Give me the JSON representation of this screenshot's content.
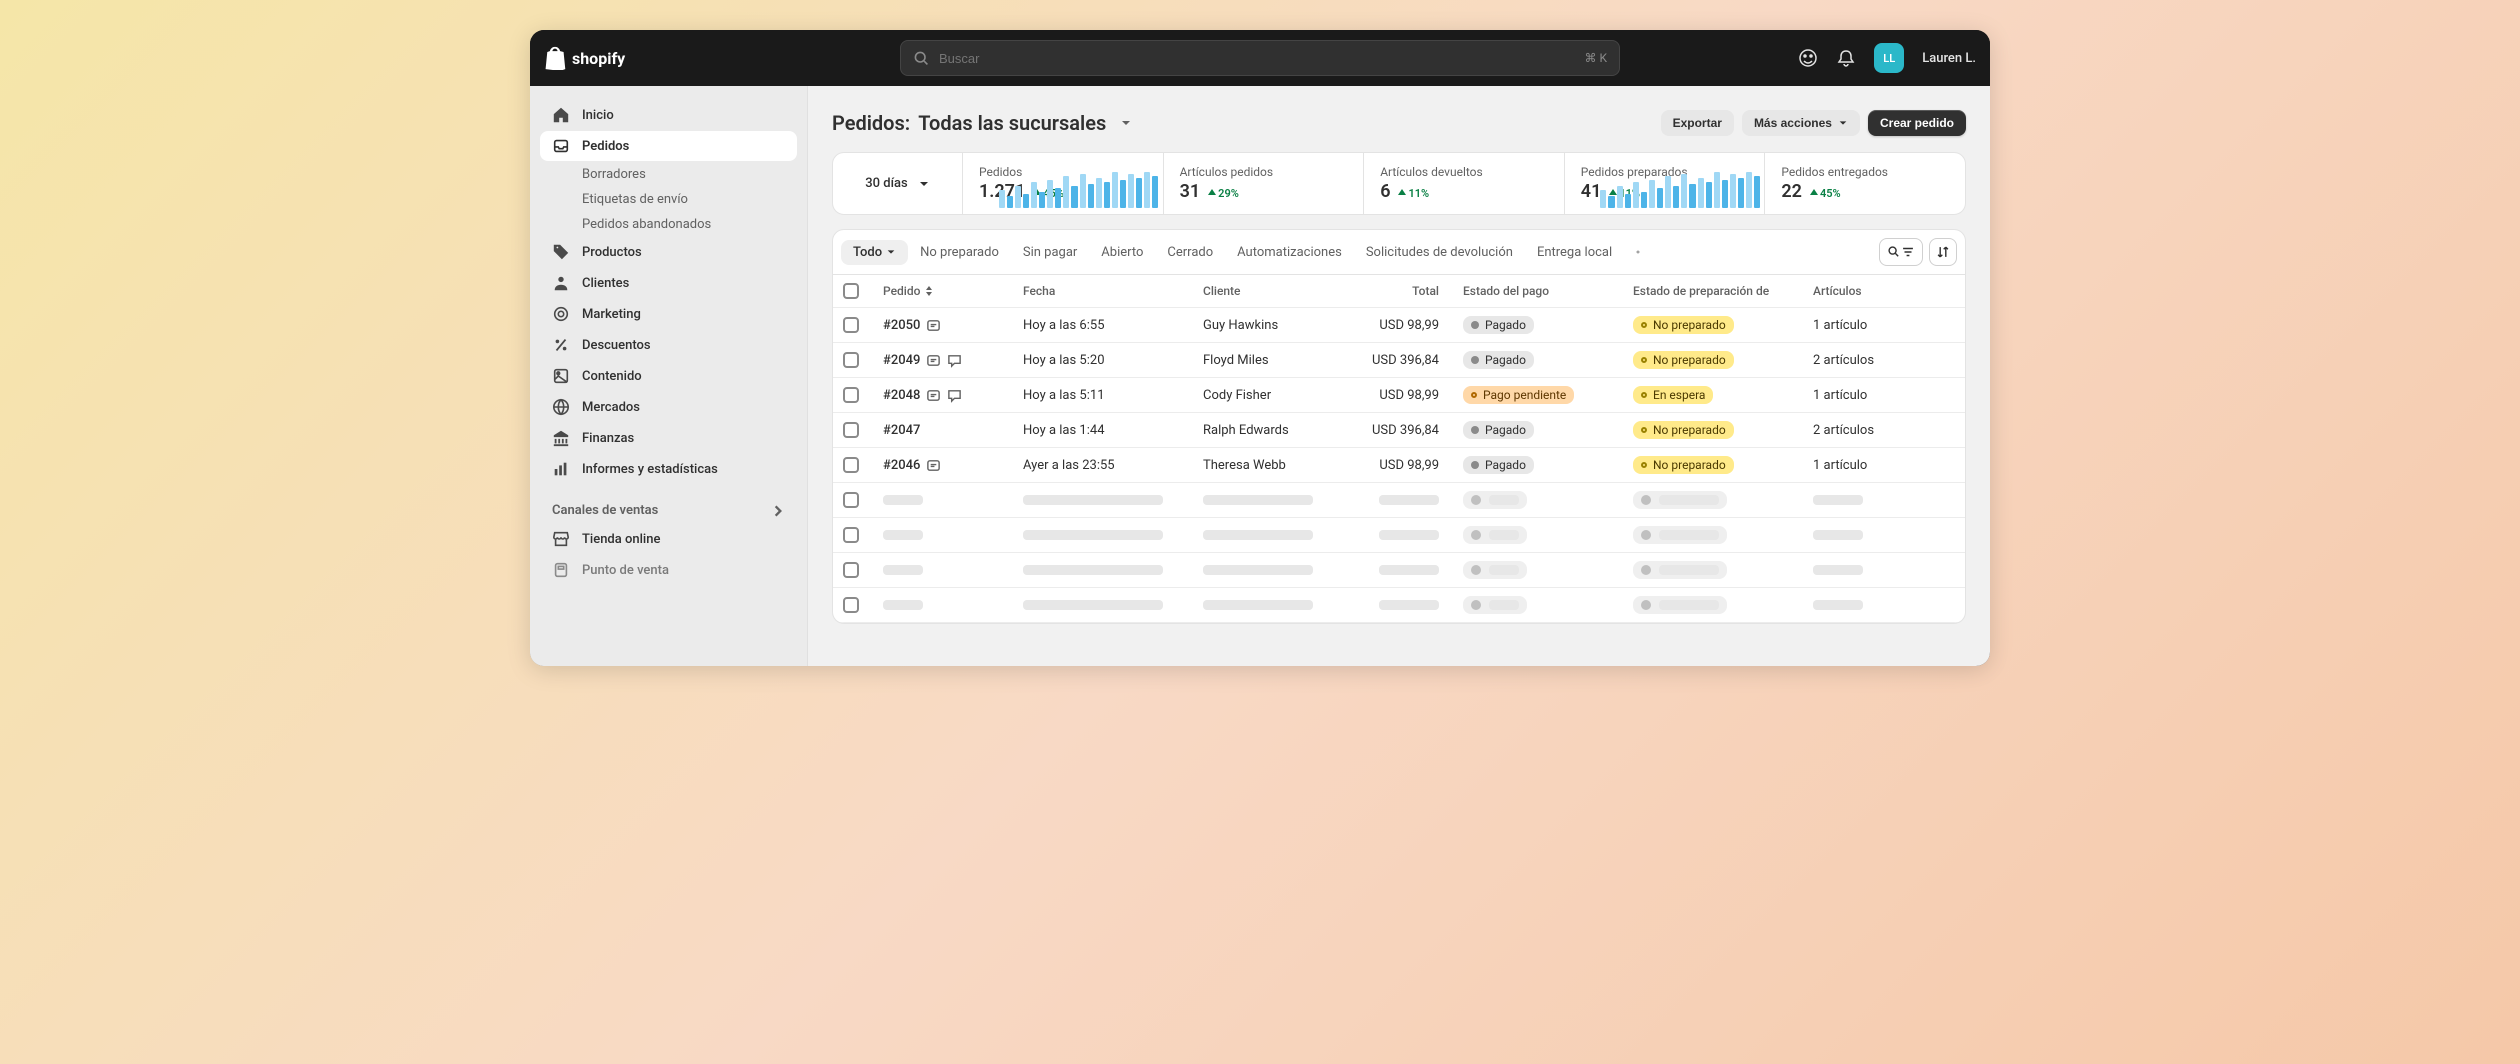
{
  "brand": "shopify",
  "search": {
    "placeholder": "Buscar",
    "shortcut": "⌘ K"
  },
  "user": {
    "initials": "LL",
    "name": "Lauren L."
  },
  "sidebar": {
    "items": [
      {
        "label": "Inicio"
      },
      {
        "label": "Pedidos"
      },
      {
        "label": "Productos"
      },
      {
        "label": "Clientes"
      },
      {
        "label": "Marketing"
      },
      {
        "label": "Descuentos"
      },
      {
        "label": "Contenido"
      },
      {
        "label": "Mercados"
      },
      {
        "label": "Finanzas"
      },
      {
        "label": "Informes y estadísticas"
      }
    ],
    "subitems": [
      {
        "label": "Borradores"
      },
      {
        "label": "Etiquetas de envío"
      },
      {
        "label": "Pedidos abandonados"
      }
    ],
    "channels_label": "Canales de ventas",
    "channels": [
      {
        "label": "Tienda online"
      },
      {
        "label": "Punto de venta"
      }
    ]
  },
  "page": {
    "title_prefix": "Pedidos:",
    "title_suffix": "Todas las sucursales",
    "export": "Exportar",
    "more_actions": "Más acciones",
    "create": "Crear pedido"
  },
  "stats": {
    "period": "30 días",
    "cells": [
      {
        "label": "Pedidos",
        "value": "1.271",
        "delta": "45%"
      },
      {
        "label": "Artículos pedidos",
        "value": "31",
        "delta": "29%"
      },
      {
        "label": "Artículos devueltos",
        "value": "6",
        "delta": "11%"
      },
      {
        "label": "Pedidos preparados",
        "value": "41",
        "delta": "11%"
      },
      {
        "label": "Pedidos entregados",
        "value": "22",
        "delta": "45%"
      }
    ]
  },
  "tabs": [
    {
      "label": "Todo",
      "active": true,
      "chevron": true
    },
    {
      "label": "No preparado"
    },
    {
      "label": "Sin pagar"
    },
    {
      "label": "Abierto"
    },
    {
      "label": "Cerrado"
    },
    {
      "label": "Automatizaciones"
    },
    {
      "label": "Solicitudes de devolución"
    },
    {
      "label": "Entrega local"
    }
  ],
  "columns": {
    "order": "Pedido",
    "date": "Fecha",
    "customer": "Cliente",
    "total": "Total",
    "payment": "Estado del pago",
    "fulfillment": "Estado de preparación de",
    "items": "Artículos"
  },
  "rows": [
    {
      "id": "#2050",
      "icons": 1,
      "date": "Hoy a las 6:55",
      "customer": "Guy Hawkins",
      "total": "USD 98,99",
      "payment": {
        "text": "Pagado",
        "kind": "gray"
      },
      "fulfillment": {
        "text": "No preparado",
        "kind": "yellow"
      },
      "items": "1 artículo"
    },
    {
      "id": "#2049",
      "icons": 2,
      "date": "Hoy a las 5:20",
      "customer": "Floyd Miles",
      "total": "USD 396,84",
      "payment": {
        "text": "Pagado",
        "kind": "gray"
      },
      "fulfillment": {
        "text": "No preparado",
        "kind": "yellow"
      },
      "items": "2 artículos"
    },
    {
      "id": "#2048",
      "icons": 2,
      "date": "Hoy a las 5:11",
      "customer": "Cody Fisher",
      "total": "USD 98,99",
      "payment": {
        "text": "Pago pendiente",
        "kind": "orange"
      },
      "fulfillment": {
        "text": "En espera",
        "kind": "yellow"
      },
      "items": "1 artículo"
    },
    {
      "id": "#2047",
      "icons": 0,
      "date": "Hoy a las 1:44",
      "customer": "Ralph Edwards",
      "total": "USD 396,84",
      "payment": {
        "text": "Pagado",
        "kind": "gray"
      },
      "fulfillment": {
        "text": "No preparado",
        "kind": "yellow"
      },
      "items": "2 artículos"
    },
    {
      "id": "#2046",
      "icons": 1,
      "date": "Ayer a las 23:55",
      "customer": "Theresa Webb",
      "total": "USD 98,99",
      "payment": {
        "text": "Pagado",
        "kind": "gray"
      },
      "fulfillment": {
        "text": "No preparado",
        "kind": "yellow"
      },
      "items": "1 artículo"
    }
  ]
}
